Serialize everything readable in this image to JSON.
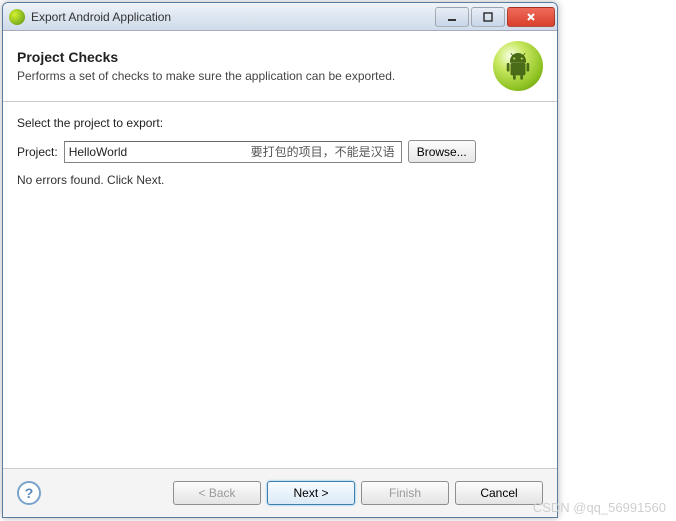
{
  "titlebar": {
    "title": "Export Android Application"
  },
  "banner": {
    "heading": "Project Checks",
    "description": "Performs a set of checks to make sure the application can be exported."
  },
  "content": {
    "prompt": "Select the project to export:",
    "project_label": "Project:",
    "project_value": "HelloWorld",
    "annotation": "要打包的项目，不能是汉语",
    "browse_label": "Browse...",
    "status": "No errors found. Click Next."
  },
  "footer": {
    "help": "?",
    "back": "< Back",
    "next": "Next >",
    "finish": "Finish",
    "cancel": "Cancel"
  },
  "watermark": "CSDN @qq_56991560"
}
